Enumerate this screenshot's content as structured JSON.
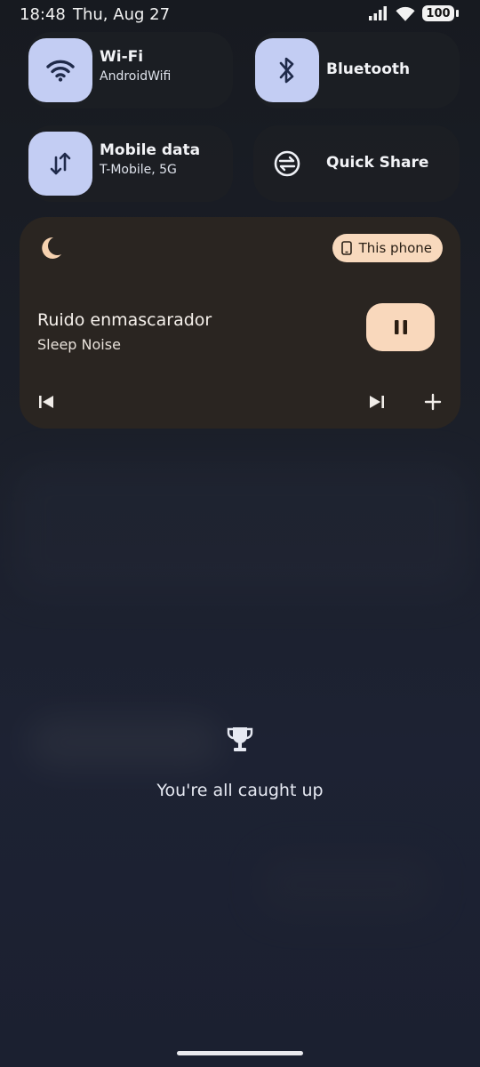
{
  "status_bar": {
    "time": "18:48",
    "date": "Thu, Aug 27",
    "battery": "100"
  },
  "tiles": [
    {
      "title": "Wi-Fi",
      "subtitle": "AndroidWifi",
      "icon": "wifi-icon",
      "active": true
    },
    {
      "title": "Bluetooth",
      "icon": "bluetooth-icon",
      "active": true
    },
    {
      "title": "Mobile data",
      "subtitle": "T-Mobile, 5G",
      "icon": "mobile-data-icon",
      "active": true
    },
    {
      "title": "Quick Share",
      "icon": "quick-share-icon",
      "active": false
    }
  ],
  "media": {
    "output": "This phone",
    "title": "Ruido enmascarador",
    "artist": "Sleep Noise",
    "app_icon": "moon-icon",
    "controls": [
      "previous-icon",
      "pause-icon",
      "next-icon",
      "add-icon"
    ]
  },
  "notifications": {
    "empty_text": "You're all caught up",
    "icon": "trophy-icon"
  },
  "colors": {
    "tile_active": "#c3cdf3",
    "media_accent": "#f9d8bc",
    "media_bg": "#2a2521"
  }
}
